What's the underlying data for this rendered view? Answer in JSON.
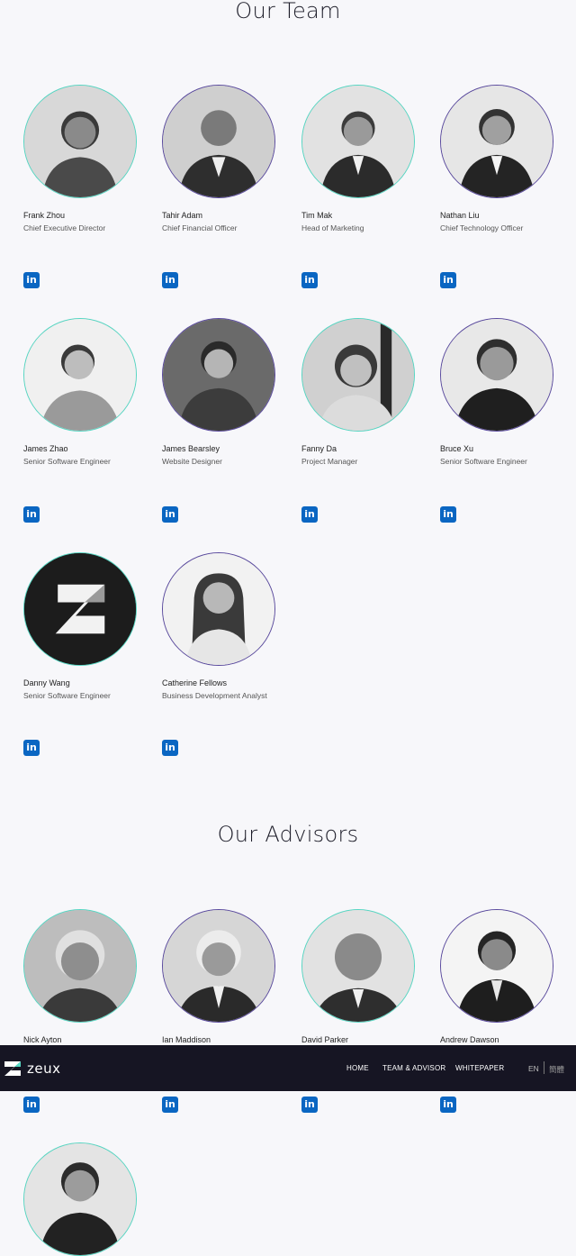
{
  "team": {
    "title": "Our Team",
    "members": [
      {
        "name": "Frank Zhou",
        "role": "Chief Executive Director"
      },
      {
        "name": "Tahir Adam",
        "role": "Chief Financial Officer"
      },
      {
        "name": "Tim Mak",
        "role": "Head of Marketing"
      },
      {
        "name": "Nathan Liu",
        "role": "Chief Technology Officer"
      },
      {
        "name": "James Zhao",
        "role": "Senior Software Engineer"
      },
      {
        "name": "James Bearsley",
        "role": "Website Designer"
      },
      {
        "name": "Fanny Da",
        "role": "Project Manager"
      },
      {
        "name": "Bruce Xu",
        "role": "Senior Software Engineer"
      },
      {
        "name": "Danny Wang",
        "role": "Senior Software Engineer"
      },
      {
        "name": "Catherine Fellows",
        "role": "Business Development Analyst"
      }
    ]
  },
  "advisors": {
    "title": "Our Advisors",
    "members": [
      {
        "name": "Nick Ayton"
      },
      {
        "name": "Ian Maddison"
      },
      {
        "name": "David Parker"
      },
      {
        "name": "Andrew Dawson"
      }
    ]
  },
  "social": {
    "linkedin_glyph": "in",
    "icon": "linkedin-icon",
    "color": "#0a66c2"
  },
  "navbar": {
    "logo_text": "zeux",
    "items": [
      "HOME",
      "TEAM & ADVISOR",
      "WHITEPAPER"
    ],
    "lang_en": "EN",
    "lang_zh": "簡體"
  },
  "colors": {
    "accent_teal": "#55d6c2",
    "accent_purple": "#5a4a9e",
    "nav_bg": "#161523"
  }
}
